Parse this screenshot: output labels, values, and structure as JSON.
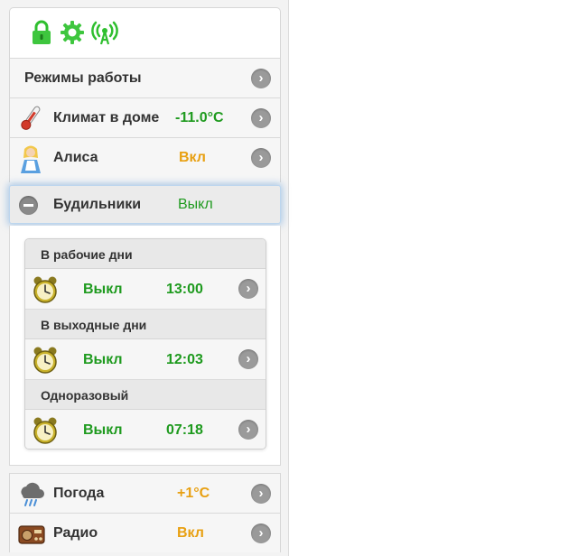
{
  "toolbar": {
    "icons": [
      "lock-icon",
      "gear-icon",
      "wifi-antenna-icon"
    ],
    "accent": "#3ec63e"
  },
  "menu": {
    "modes": {
      "label": "Режимы работы"
    },
    "climate": {
      "label": "Климат в доме",
      "value": "-11.0°C"
    },
    "alice": {
      "label": "Алиса",
      "value": "Вкл"
    },
    "alarms": {
      "label": "Будильники",
      "value": "Выкл"
    },
    "weather": {
      "label": "Погода",
      "value": "+1°C"
    },
    "radio": {
      "label": "Радио",
      "value": "Вкл"
    }
  },
  "alarms": {
    "groups": [
      {
        "title": "В рабочие дни",
        "status": "Выкл",
        "time": "13:00"
      },
      {
        "title": "В выходные дни",
        "status": "Выкл",
        "time": "12:03"
      },
      {
        "title": "Одноразовый",
        "status": "Выкл",
        "time": "07:18"
      }
    ]
  },
  "colors": {
    "on": "#e8a012",
    "off": "#1e9a1e",
    "temp": "#1e9a1e"
  }
}
